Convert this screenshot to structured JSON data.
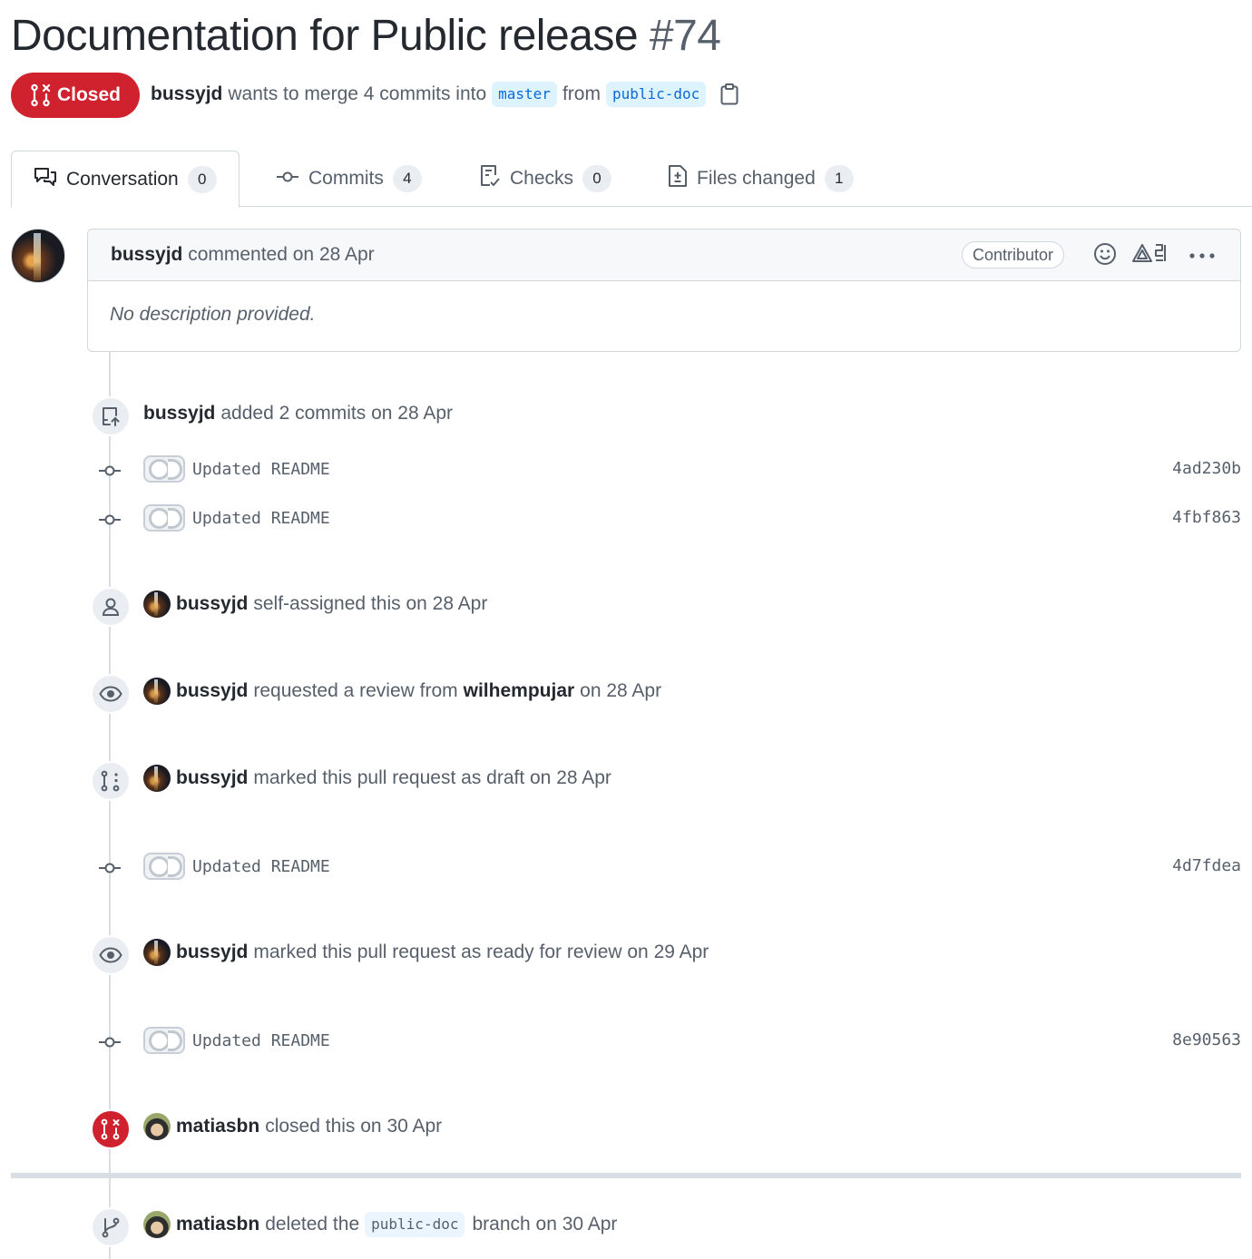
{
  "pr": {
    "title": "Documentation for Public release",
    "number": "#74",
    "state": "Closed",
    "author": "bussyjd",
    "merge_text": "wants to merge 4 commits into",
    "base_branch": "master",
    "from_text": "from",
    "head_branch": "public-doc"
  },
  "tabs": [
    {
      "label": "Conversation",
      "count": "0"
    },
    {
      "label": "Commits",
      "count": "4"
    },
    {
      "label": "Checks",
      "count": "0"
    },
    {
      "label": "Files changed",
      "count": "1"
    }
  ],
  "comment": {
    "author": "bussyjd",
    "action": "commented on 28 Apr",
    "role": "Contributor",
    "body": "No description provided."
  },
  "timeline": {
    "added_commits": {
      "user": "bussyjd",
      "text": "added 2 commits on 28 Apr"
    },
    "commits": [
      {
        "message": "Updated README",
        "sha": "4ad230b"
      },
      {
        "message": "Updated README",
        "sha": "4fbf863"
      },
      {
        "message": "Updated README",
        "sha": "4d7fdea"
      },
      {
        "message": "Updated README",
        "sha": "8e90563"
      }
    ],
    "self_assigned": {
      "user": "bussyjd",
      "text": "self-assigned this on 28 Apr"
    },
    "review_request": {
      "user": "bussyjd",
      "text": "requested a review from",
      "reviewer": "wilhempujar",
      "date": "on 28 Apr"
    },
    "draft": {
      "user": "bussyjd",
      "text": "marked this pull request as draft on 28 Apr"
    },
    "ready": {
      "user": "bussyjd",
      "text": "marked this pull request as ready for review on 29 Apr"
    },
    "closed": {
      "user": "matiasbn",
      "text": "closed this on 30 Apr"
    },
    "deleted": {
      "user": "matiasbn",
      "text_before": "deleted the",
      "branch": "public-doc",
      "text_after": "branch on 30 Apr"
    }
  },
  "colors": {
    "closed_red": "#cf222e",
    "link_blue": "#0969da",
    "muted": "#57606a"
  },
  "icons": {
    "state": "git-pull-request-closed-icon",
    "copy": "copy-icon",
    "conversation": "comment-discussion-icon",
    "commits": "git-commit-icon",
    "checks": "checklist-icon",
    "files": "file-diff-icon",
    "emoji": "smiley-icon",
    "translate": "translate-icon",
    "more": "kebab-horizontal-icon",
    "push": "repo-push-icon",
    "person": "person-icon",
    "eye": "eye-icon",
    "draft": "git-pull-request-draft-icon",
    "branch": "git-branch-icon"
  }
}
